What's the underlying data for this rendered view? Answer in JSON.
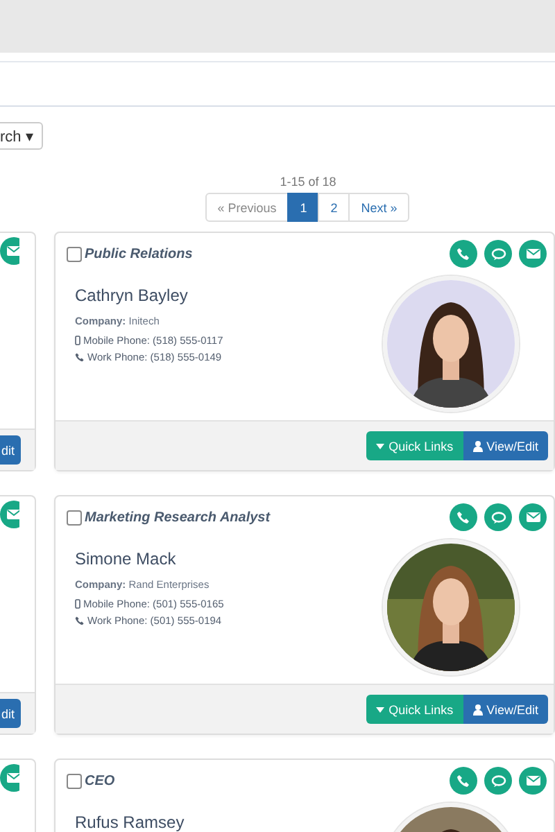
{
  "search_button": {
    "label": "rch",
    "caret": "▾"
  },
  "pagination": {
    "summary": "1-15 of 18",
    "pages": [
      {
        "label": "« Previous",
        "selected": false
      },
      {
        "label": "1",
        "selected": true
      },
      {
        "label": "2",
        "selected": false
      },
      {
        "label": "Next »",
        "selected": false
      }
    ]
  },
  "left_cards": [
    {
      "kind": "full",
      "button": "dit"
    },
    {
      "kind": "full",
      "button": "dit"
    },
    {
      "kind": "cut"
    }
  ],
  "cards": [
    {
      "title": "Public Relations",
      "checked": false,
      "name": "Cathryn Bayley",
      "company_label": "Company:",
      "company": "Initech",
      "mobile": "Mobile Phone: (518) 555-0117",
      "work": "Work Phone: (518) 555-0149",
      "quick_links": "Quick Links",
      "view_edit": "View/Edit"
    },
    {
      "title": "Marketing Research Analyst",
      "checked": false,
      "name": "Simone Mack",
      "company_label": "Company:",
      "company": "Rand Enterprises",
      "mobile": "Mobile Phone: (501) 555-0165",
      "work": "Work Phone: (501) 555-0194",
      "quick_links": "Quick Links",
      "view_edit": "View/Edit"
    },
    {
      "title": "CEO",
      "checked": false,
      "name": "Rufus Ramsey"
    }
  ]
}
